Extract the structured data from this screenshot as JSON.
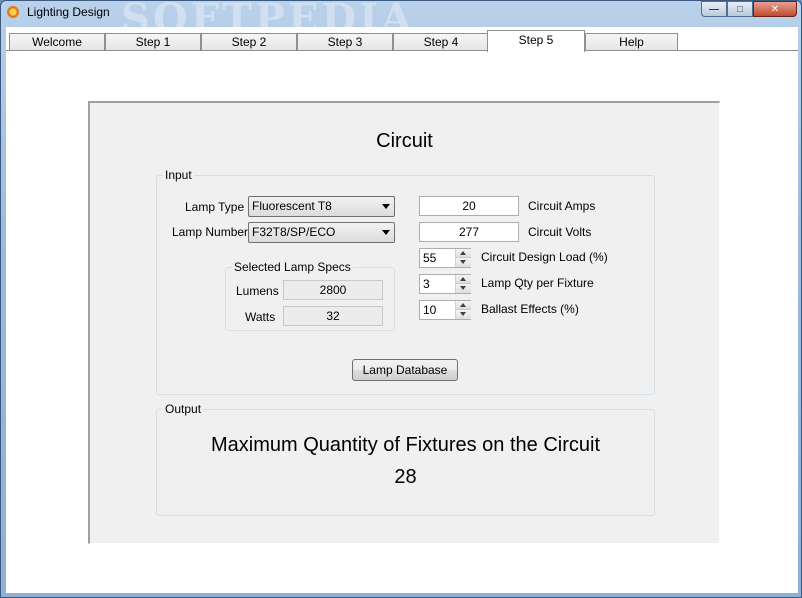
{
  "window": {
    "title": "Lighting Design",
    "watermark": "SOFTPEDIA",
    "minimize_glyph": "—",
    "maximize_glyph": "□",
    "close_glyph": "✕"
  },
  "tabs": [
    {
      "label": "Welcome"
    },
    {
      "label": "Step 1"
    },
    {
      "label": "Step 2"
    },
    {
      "label": "Step 3"
    },
    {
      "label": "Step 4"
    },
    {
      "label": "Step 5",
      "active": true
    },
    {
      "label": "Help"
    }
  ],
  "circuit": {
    "title": "Circuit",
    "input": {
      "group_label": "Input",
      "lamp_type": {
        "label": "Lamp Type",
        "value": "Fluorescent T8"
      },
      "lamp_number": {
        "label": "Lamp Number",
        "value": "F32T8/SP/ECO"
      },
      "specs": {
        "group_label": "Selected Lamp Specs",
        "lumens_label": "Lumens",
        "lumens_value": "2800",
        "watts_label": "Watts",
        "watts_value": "32"
      },
      "circuit_amps": {
        "value": "20",
        "label": "Circuit Amps"
      },
      "circuit_volts": {
        "value": "277",
        "label": "Circuit Volts"
      },
      "design_load": {
        "value": "55",
        "label": "Circuit Design Load (%)"
      },
      "lamp_qty": {
        "value": "3",
        "label": "Lamp Qty per Fixture"
      },
      "ballast_effects": {
        "value": "10",
        "label": "Ballast Effects (%)"
      },
      "lamp_database_button": "Lamp Database"
    },
    "output": {
      "group_label": "Output",
      "heading": "Maximum Quantity of Fixtures on the Circuit",
      "value": "28"
    }
  }
}
